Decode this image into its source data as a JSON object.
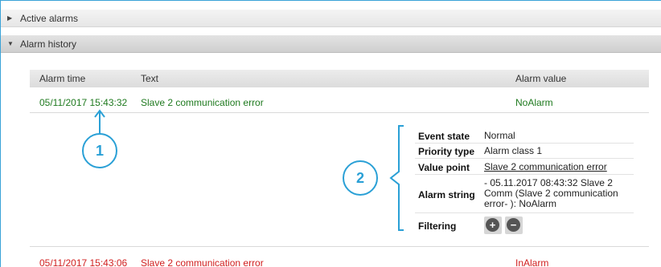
{
  "sections": {
    "active_alarms": "Active alarms",
    "alarm_history": "Alarm history"
  },
  "table": {
    "headers": {
      "time": "Alarm time",
      "text": "Text",
      "value": "Alarm value"
    },
    "rows": [
      {
        "time": "05/11/2017 15:43:32",
        "text": "Slave 2 communication error",
        "value": "NoAlarm",
        "color": "#1f7a1f"
      },
      {
        "time": "05/11/2017 15:43:06",
        "text": "Slave 2 communication error",
        "value": "InAlarm",
        "color": "#d12020"
      }
    ]
  },
  "details": {
    "event_state_label": "Event state",
    "event_state": "Normal",
    "priority_type_label": "Priority type",
    "priority_type": "Alarm class 1",
    "value_point_label": "Value point",
    "value_point": "Slave 2 communication error",
    "alarm_string_label": "Alarm string",
    "alarm_string": "- 05.11.2017 08:43:32 Slave 2 Comm (Slave 2 communication error- ): NoAlarm",
    "filtering_label": "Filtering",
    "add_symbol": "+",
    "remove_symbol": "−"
  },
  "callouts": {
    "one": "1",
    "two": "2"
  },
  "colors": {
    "accent": "#2aa0d6"
  }
}
